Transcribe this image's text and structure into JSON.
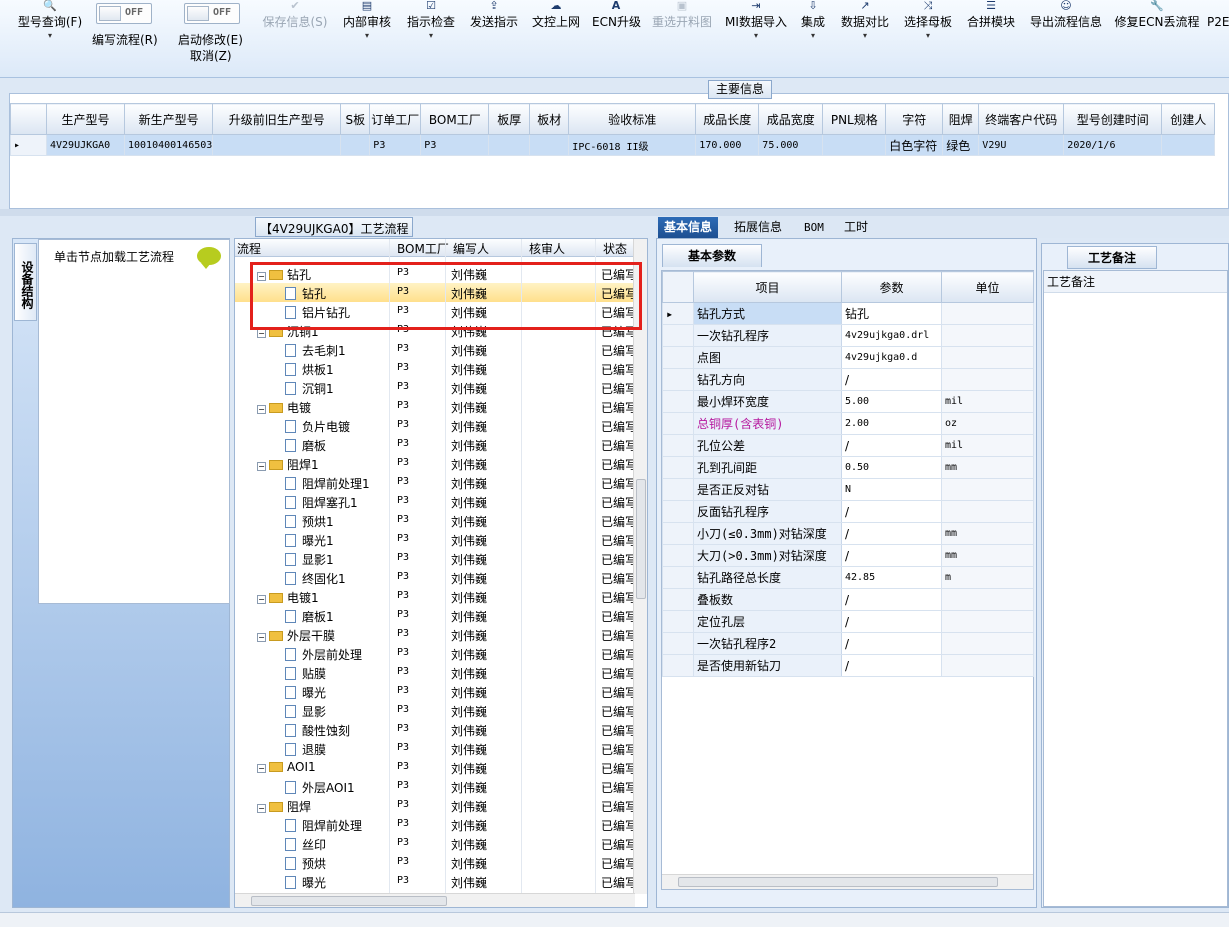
{
  "ribbon": {
    "model_query": "型号查询(F)",
    "edit_flow_toggle": "OFF",
    "edit_flow": "编写流程(R)",
    "start_edit_toggle": "OFF",
    "start_edit": "启动修改(E)",
    "cancel": "取消(Z)",
    "save_info": "保存信息(S)",
    "internal_review": "内部审核",
    "instruction_check": "指示检查",
    "send_instruction": "发送指示",
    "doc_upload": "文控上网",
    "ecn_upgrade": "ECN升级",
    "reselect_material": "重选开料图",
    "mi_import": "MI数据导入",
    "integrate": "集成",
    "data_compare": "数据对比",
    "select_master": "选择母板",
    "combine_module": "合拼模块",
    "export_flow": "导出流程信息",
    "fix_ecn_flow": "修复ECN丢流程",
    "p2e": "P2E"
  },
  "main_info": {
    "title": "主要信息",
    "columns": [
      "生产型号",
      "新生产型号",
      "升级前旧生产型号",
      "S板",
      "订单工厂",
      "BOM工厂",
      "板厚",
      "板材",
      "验收标准",
      "成品长度",
      "成品宽度",
      "PNL规格",
      "字符",
      "阻焊",
      "终端客户代码",
      "型号创建时间",
      "创建人"
    ],
    "row": [
      "4V29UJKGA0",
      "10010400146503",
      "",
      "",
      "P3",
      "P3",
      "",
      "",
      "IPC-6018 II级",
      "170.000",
      "75.000",
      "",
      "白色字符",
      "绿色",
      "V29U",
      "2020/1/6",
      ""
    ]
  },
  "left_panel": {
    "vertical_tab": "设备结构",
    "title": "单击节点加载工艺流程"
  },
  "flow_panel": {
    "title": "【4V29UJKGA0】工艺流程",
    "headers": {
      "flow": "流程",
      "bom": "BOM工厂",
      "author": "编写人",
      "reviewer": "核审人",
      "status": "状态"
    },
    "rows": [
      {
        "name": "钻孔",
        "level": 1,
        "bom": "P3",
        "author": "刘伟巍",
        "status": "已编写"
      },
      {
        "name": "钻孔",
        "level": 2,
        "bom": "P3",
        "author": "刘伟巍",
        "status": "已编写"
      },
      {
        "name": "铝片钻孔",
        "level": 2,
        "bom": "P3",
        "author": "刘伟巍",
        "status": "已编写"
      },
      {
        "name": "沉铜1",
        "level": 1,
        "bom": "P3",
        "author": "刘伟巍",
        "status": "已编写"
      },
      {
        "name": "去毛刺1",
        "level": 2,
        "bom": "P3",
        "author": "刘伟巍",
        "status": "已编写"
      },
      {
        "name": "烘板1",
        "level": 2,
        "bom": "P3",
        "author": "刘伟巍",
        "status": "已编写"
      },
      {
        "name": "沉铜1",
        "level": 2,
        "bom": "P3",
        "author": "刘伟巍",
        "status": "已编写"
      },
      {
        "name": "电镀",
        "level": 1,
        "bom": "P3",
        "author": "刘伟巍",
        "status": "已编写"
      },
      {
        "name": "负片电镀",
        "level": 2,
        "bom": "P3",
        "author": "刘伟巍",
        "status": "已编写"
      },
      {
        "name": "磨板",
        "level": 2,
        "bom": "P3",
        "author": "刘伟巍",
        "status": "已编写"
      },
      {
        "name": "阻焊1",
        "level": 1,
        "bom": "P3",
        "author": "刘伟巍",
        "status": "已编写"
      },
      {
        "name": "阻焊前处理1",
        "level": 2,
        "bom": "P3",
        "author": "刘伟巍",
        "status": "已编写"
      },
      {
        "name": "阻焊塞孔1",
        "level": 2,
        "bom": "P3",
        "author": "刘伟巍",
        "status": "已编写"
      },
      {
        "name": "预烘1",
        "level": 2,
        "bom": "P3",
        "author": "刘伟巍",
        "status": "已编写"
      },
      {
        "name": "曝光1",
        "level": 2,
        "bom": "P3",
        "author": "刘伟巍",
        "status": "已编写"
      },
      {
        "name": "显影1",
        "level": 2,
        "bom": "P3",
        "author": "刘伟巍",
        "status": "已编写"
      },
      {
        "name": "终固化1",
        "level": 2,
        "bom": "P3",
        "author": "刘伟巍",
        "status": "已编写"
      },
      {
        "name": "电镀1",
        "level": 1,
        "bom": "P3",
        "author": "刘伟巍",
        "status": "已编写"
      },
      {
        "name": "磨板1",
        "level": 2,
        "bom": "P3",
        "author": "刘伟巍",
        "status": "已编写"
      },
      {
        "name": "外层干膜",
        "level": 1,
        "bom": "P3",
        "author": "刘伟巍",
        "status": "已编写"
      },
      {
        "name": "外层前处理",
        "level": 2,
        "bom": "P3",
        "author": "刘伟巍",
        "status": "已编写"
      },
      {
        "name": "贴膜",
        "level": 2,
        "bom": "P3",
        "author": "刘伟巍",
        "status": "已编写"
      },
      {
        "name": "曝光",
        "level": 2,
        "bom": "P3",
        "author": "刘伟巍",
        "status": "已编写"
      },
      {
        "name": "显影",
        "level": 2,
        "bom": "P3",
        "author": "刘伟巍",
        "status": "已编写"
      },
      {
        "name": "酸性蚀刻",
        "level": 2,
        "bom": "P3",
        "author": "刘伟巍",
        "status": "已编写"
      },
      {
        "name": "退膜",
        "level": 2,
        "bom": "P3",
        "author": "刘伟巍",
        "status": "已编写"
      },
      {
        "name": "AOI1",
        "level": 1,
        "bom": "P3",
        "author": "刘伟巍",
        "status": "已编写"
      },
      {
        "name": "外层AOI1",
        "level": 2,
        "bom": "P3",
        "author": "刘伟巍",
        "status": "已编写"
      },
      {
        "name": "阻焊",
        "level": 1,
        "bom": "P3",
        "author": "刘伟巍",
        "status": "已编写"
      },
      {
        "name": "阻焊前处理",
        "level": 2,
        "bom": "P3",
        "author": "刘伟巍",
        "status": "已编写"
      },
      {
        "name": "丝印",
        "level": 2,
        "bom": "P3",
        "author": "刘伟巍",
        "status": "已编写"
      },
      {
        "name": "预烘",
        "level": 2,
        "bom": "P3",
        "author": "刘伟巍",
        "status": "已编写"
      },
      {
        "name": "曝光",
        "level": 2,
        "bom": "P3",
        "author": "刘伟巍",
        "status": "已编写"
      }
    ]
  },
  "detail_tabs": [
    "基本信息",
    "拓展信息",
    "BOM",
    "工时"
  ],
  "basic_params": {
    "subtab": "基本参数",
    "headers": [
      "项目",
      "参数",
      "单位"
    ],
    "rows": [
      {
        "item": "钻孔方式",
        "value": "钻孔",
        "unit": ""
      },
      {
        "item": "一次钻孔程序",
        "value": "4v29ujkga0.drl",
        "unit": ""
      },
      {
        "item": "点图",
        "value": "4v29ujkga0.d",
        "unit": ""
      },
      {
        "item": "钻孔方向",
        "value": "/",
        "unit": ""
      },
      {
        "item": "最小焊环宽度",
        "value": "5.00",
        "unit": "mil"
      },
      {
        "item": "总铜厚(含表铜)",
        "value": "2.00",
        "unit": "oz"
      },
      {
        "item": "孔位公差",
        "value": "/",
        "unit": "mil"
      },
      {
        "item": "孔到孔间距",
        "value": "0.50",
        "unit": "mm"
      },
      {
        "item": "是否正反对钻",
        "value": "N",
        "unit": ""
      },
      {
        "item": "反面钻孔程序",
        "value": "/",
        "unit": ""
      },
      {
        "item": "小刀(≤0.3mm)对钻深度",
        "value": "/",
        "unit": "mm"
      },
      {
        "item": "大刀(>0.3mm)对钻深度",
        "value": "/",
        "unit": "mm"
      },
      {
        "item": "钻孔路径总长度",
        "value": "42.85",
        "unit": "m"
      },
      {
        "item": "叠板数",
        "value": "/",
        "unit": ""
      },
      {
        "item": "定位孔层",
        "value": "/",
        "unit": ""
      },
      {
        "item": "一次钻孔程序2",
        "value": "/",
        "unit": ""
      },
      {
        "item": "是否使用新钻刀",
        "value": "/",
        "unit": ""
      }
    ]
  },
  "remarks": {
    "tab": "工艺备注",
    "header": "工艺备注"
  },
  "colors": {
    "accent": "#1d4f91",
    "highlight_item": "#b5179e",
    "red_box": "#e3201b"
  }
}
